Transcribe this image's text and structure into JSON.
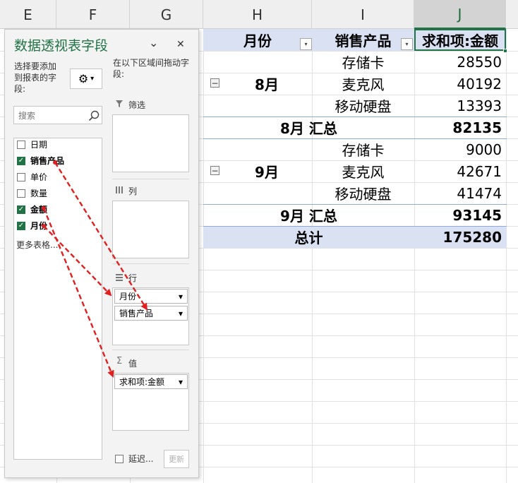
{
  "columns": {
    "E": "E",
    "F": "F",
    "G": "G",
    "H": "H",
    "I": "I",
    "J": "J"
  },
  "pivot": {
    "header": {
      "month": "月份",
      "product": "销售产品",
      "value": "求和项:金额"
    },
    "groups": [
      {
        "month": "8月",
        "rows": [
          {
            "product": "存储卡",
            "amount": "28550"
          },
          {
            "product": "麦克风",
            "amount": "40192"
          },
          {
            "product": "移动硬盘",
            "amount": "13393"
          }
        ],
        "subtotal_label": "8月 汇总",
        "subtotal": "82135"
      },
      {
        "month": "9月",
        "rows": [
          {
            "product": "存储卡",
            "amount": "9000"
          },
          {
            "product": "麦克风",
            "amount": "42671"
          },
          {
            "product": "移动硬盘",
            "amount": "41474"
          }
        ],
        "subtotal_label": "9月 汇总",
        "subtotal": "93145"
      }
    ],
    "total_label": "总计",
    "total": "175280",
    "collapse_symbol": "−"
  },
  "pane": {
    "title": "数据透视表字段",
    "chevron": "⌄",
    "close": "✕",
    "choose_label": "选择要添加到报表的字段:",
    "drag_label": "在以下区域间拖动字段:",
    "gear": "⚙",
    "search_placeholder": "搜索",
    "fields": [
      {
        "name": "日期",
        "checked": false
      },
      {
        "name": "销售产品",
        "checked": true
      },
      {
        "name": "单价",
        "checked": false
      },
      {
        "name": "数量",
        "checked": false
      },
      {
        "name": "金额",
        "checked": true
      },
      {
        "name": "月份",
        "checked": true
      }
    ],
    "more_tables": "更多表格...",
    "areas": {
      "filter": "筛选",
      "columns": "列",
      "rows": "行",
      "values": "值"
    },
    "row_fields": [
      "月份",
      "销售产品"
    ],
    "value_fields": [
      "求和项:金额"
    ],
    "defer_label": "延迟...",
    "update_button": "更新",
    "check_glyph": "✓",
    "dropdown_glyph": "▾"
  },
  "colors": {
    "accent": "#217346",
    "pivot_header": "#d9e1f2",
    "arrow": "#e02020"
  }
}
